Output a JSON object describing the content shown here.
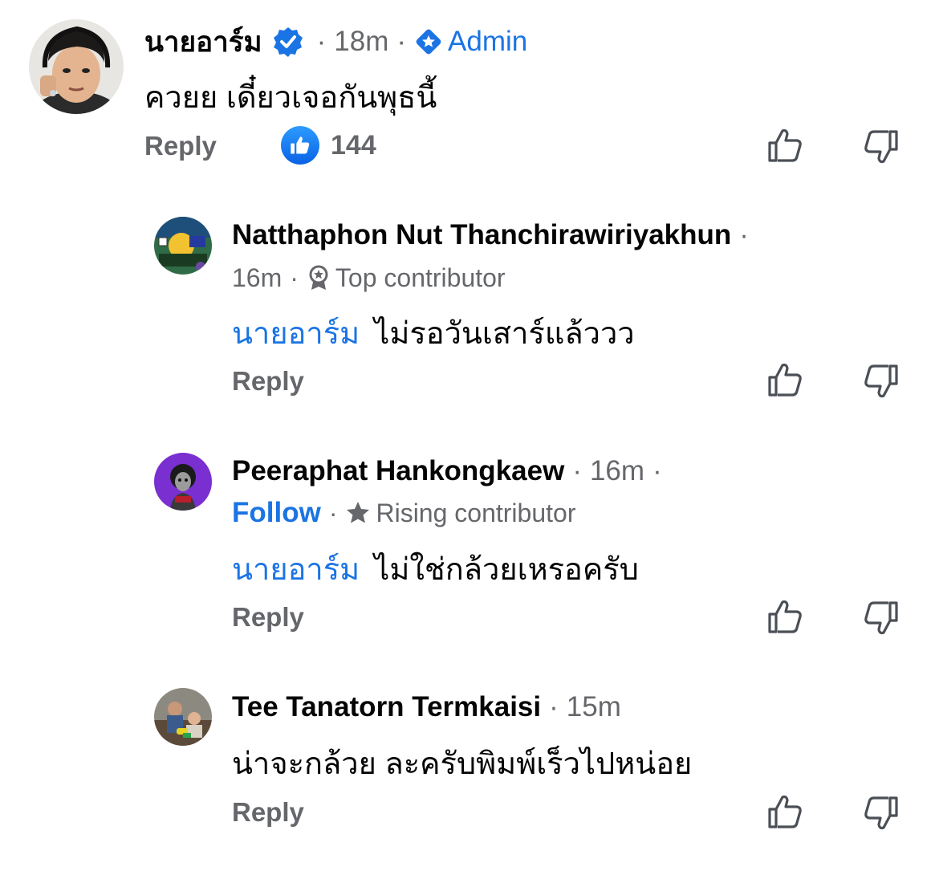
{
  "comments": [
    {
      "name": "นายอาร์ม",
      "time": "18m",
      "role": "Admin",
      "text": "ควยย เดี๋ยวเจอกันพุธนี้",
      "reply_label": "Reply",
      "like_count": "144"
    },
    {
      "name": "Natthaphon Nut Thanchirawiriyakhun",
      "time": "16m",
      "badge": "Top contributor",
      "mention": "นายอาร์ม",
      "text": "ไม่รอวันเสาร์แล้ววว",
      "reply_label": "Reply"
    },
    {
      "name": "Peeraphat Hankongkaew",
      "time": "16m",
      "follow_label": "Follow",
      "badge": "Rising contributor",
      "mention": "นายอาร์ม",
      "text": "ไม่ใช่กล้วยเหรอครับ",
      "reply_label": "Reply"
    },
    {
      "name": "Tee Tanatorn Termkaisi",
      "time": "15m",
      "text": "น่าจะกล้วย ละครับพิมพ์เร็วไปหน่อย",
      "reply_label": "Reply"
    }
  ],
  "colors": {
    "accent": "#1b74e4",
    "meta_gray": "#65676b",
    "like_blue": "#0a62e5"
  },
  "icons": [
    "verified-badge-icon",
    "admin-diamond-icon",
    "like-reaction-icon",
    "thumbs-up-icon",
    "thumbs-down-icon",
    "contributor-badge-icon",
    "star-icon"
  ]
}
